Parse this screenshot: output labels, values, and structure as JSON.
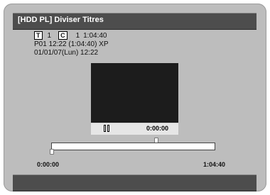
{
  "title": "[HDD PL] Diviser Titres",
  "info": {
    "title_badge": "T",
    "title_number": "1",
    "chapter_badge": "C",
    "chapter_number": "1",
    "total_time": "1:04:40",
    "line2": "P01  12:22 (1:04:40) XP",
    "line3": "01/01/07(Lun)   12:22"
  },
  "preview": {
    "state_icon": "pause-icon",
    "time": "0:00:00"
  },
  "timeline": {
    "start_label": "0:00:00",
    "end_label": "1:04:40",
    "current_position_fraction": 0.64
  },
  "colors": {
    "screen_bg": "#bdbdbd",
    "title_bar": "#4d4d4d",
    "preview_bg": "#1c1c1c"
  }
}
